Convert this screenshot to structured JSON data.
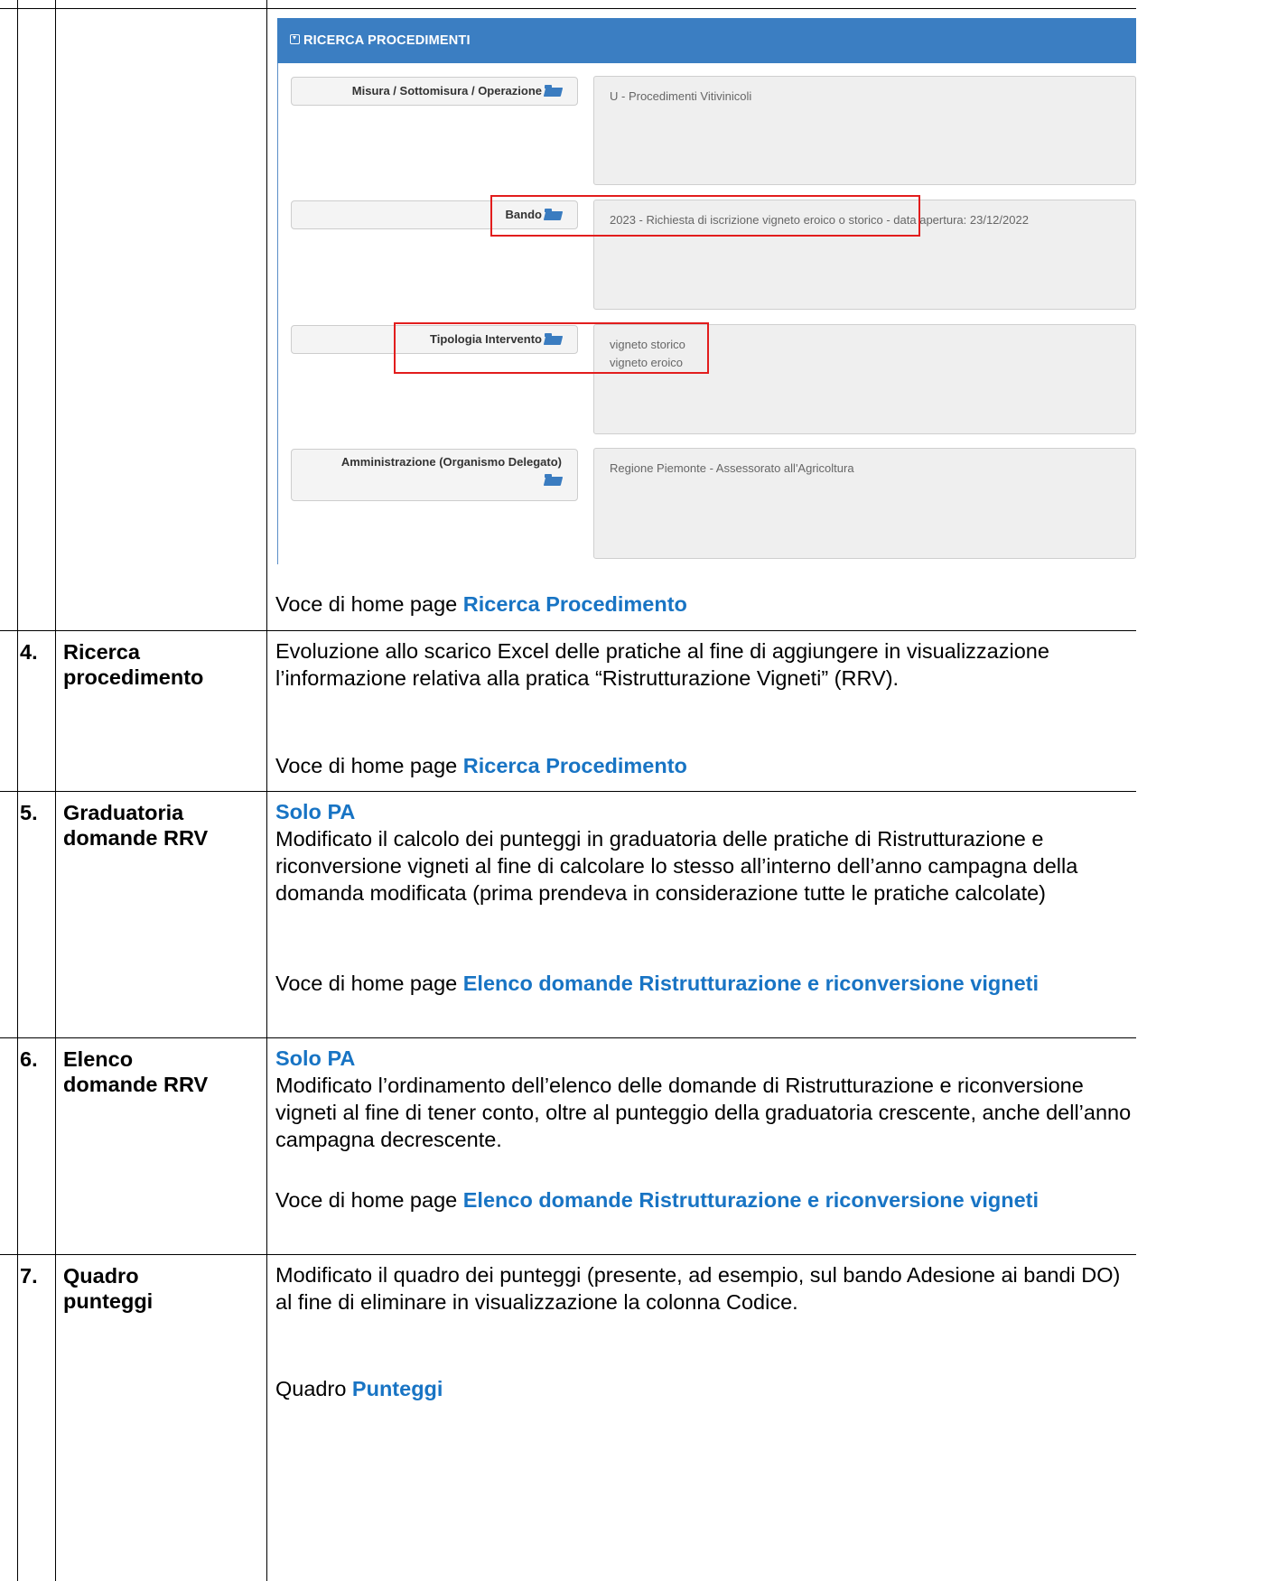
{
  "screenshot": {
    "header": "RICERCA PROCEDIMENTI",
    "fields": [
      {
        "label": "Misura / Sottomisura / Operazione",
        "values": [
          "U - Procedimenti Vitivinicoli"
        ]
      },
      {
        "label": "Bando",
        "values": [
          "2023 - Richiesta di iscrizione vigneto eroico o storico - data apertura: 23/12/2022"
        ]
      },
      {
        "label": "Tipologia Intervento",
        "values": [
          "vigneto storico",
          "vigneto eroico"
        ]
      },
      {
        "label": "Amministrazione (Organismo Delegato)",
        "values": [
          "Regione Piemonte - Assessorato all'Agricoltura"
        ]
      }
    ],
    "folder_icon": "folder-open-icon",
    "highlight_color": "#e21d1d",
    "header_color": "#3b7ec2"
  },
  "row3": {
    "footer_prefix": "Voce di home page ",
    "footer_link": "Ricerca Procedimento"
  },
  "rows": [
    {
      "num": "4.",
      "title": [
        "Ricerca",
        "procedimento"
      ],
      "tag": "",
      "desc": "Evoluzione allo scarico Excel delle pratiche al fine di aggiungere in visualizzazione l’informazione relativa alla pratica “Ristrutturazione Vigneti” (RRV).",
      "footer_prefix": "Voce di home page ",
      "footer_link": "Ricerca Procedimento"
    },
    {
      "num": "5.",
      "title": [
        "Graduatoria",
        "domande RRV"
      ],
      "tag": "Solo PA",
      "desc": "Modificato il calcolo dei punteggi in graduatoria delle pratiche di Ristrutturazione e riconversione vigneti al fine di calcolare lo stesso all’interno dell’anno campagna della domanda modificata (prima prendeva in considerazione tutte le pratiche calcolate)",
      "footer_prefix": "Voce di home page ",
      "footer_link": "Elenco domande Ristrutturazione e riconversione vigneti"
    },
    {
      "num": "6.",
      "title": [
        "Elenco",
        "domande RRV"
      ],
      "tag": "Solo PA",
      "desc": "Modificato l’ordinamento dell’elenco delle domande di Ristrutturazione e riconversione vigneti al fine di tener conto, oltre al punteggio della graduatoria crescente, anche dell’anno campagna decrescente.",
      "footer_prefix": "Voce di home page ",
      "footer_link": "Elenco domande Ristrutturazione e riconversione vigneti"
    },
    {
      "num": "7.",
      "title": [
        "Quadro",
        "punteggi"
      ],
      "tag": "",
      "desc": "Modificato il quadro dei punteggi (presente, ad esempio, sul bando Adesione ai bandi DO) al fine di eliminare in visualizzazione la colonna Codice.",
      "footer_prefix": "Quadro ",
      "footer_link": "Punteggi"
    }
  ],
  "link_color": "#1874c4"
}
